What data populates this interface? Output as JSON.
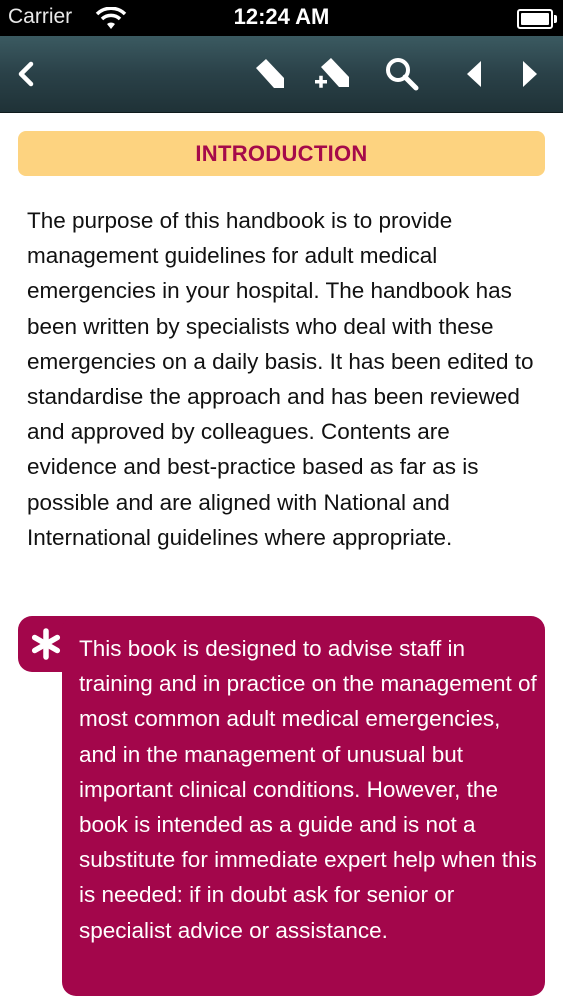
{
  "status_bar": {
    "carrier": "Carrier",
    "time": "12:24 AM"
  },
  "toolbar": {
    "buttons": [
      {
        "name": "back",
        "icon": "chevron-left-icon"
      },
      {
        "name": "bookmark",
        "icon": "bookmark-icon"
      },
      {
        "name": "add-bookmark",
        "icon": "bookmark-add-icon"
      },
      {
        "name": "search",
        "icon": "search-icon"
      },
      {
        "name": "previous",
        "icon": "triangle-left-icon"
      },
      {
        "name": "next",
        "icon": "triangle-right-icon"
      }
    ]
  },
  "content": {
    "section_title": "INTRODUCTION",
    "paragraph": "The purpose of this handbook is to provide management guidelines for adult medical emergencies in your hospital. The handbook has been written by specialists who deal with these emergencies on a daily basis. It has been edited to standardise the approach and has been reviewed and approved by colleagues. Contents are evidence and best-practice based as far as is possible and are aligned with National and International guidelines where appropriate.",
    "callout": {
      "icon": "asterisk-icon",
      "text": "This book is designed to advise staff in training and in practice on the management of most common adult medical emergencies, and in the management of unusual but important clinical conditions. However, the book is intended as a guide and is not a substitute for immediate expert help when this is needed: if in doubt ask for senior or specialist advice or assistance."
    }
  },
  "colors": {
    "toolbar": "#2a4148",
    "header_bg": "#fdd380",
    "header_text": "#a50a4a",
    "callout_bg": "#a3064b"
  }
}
